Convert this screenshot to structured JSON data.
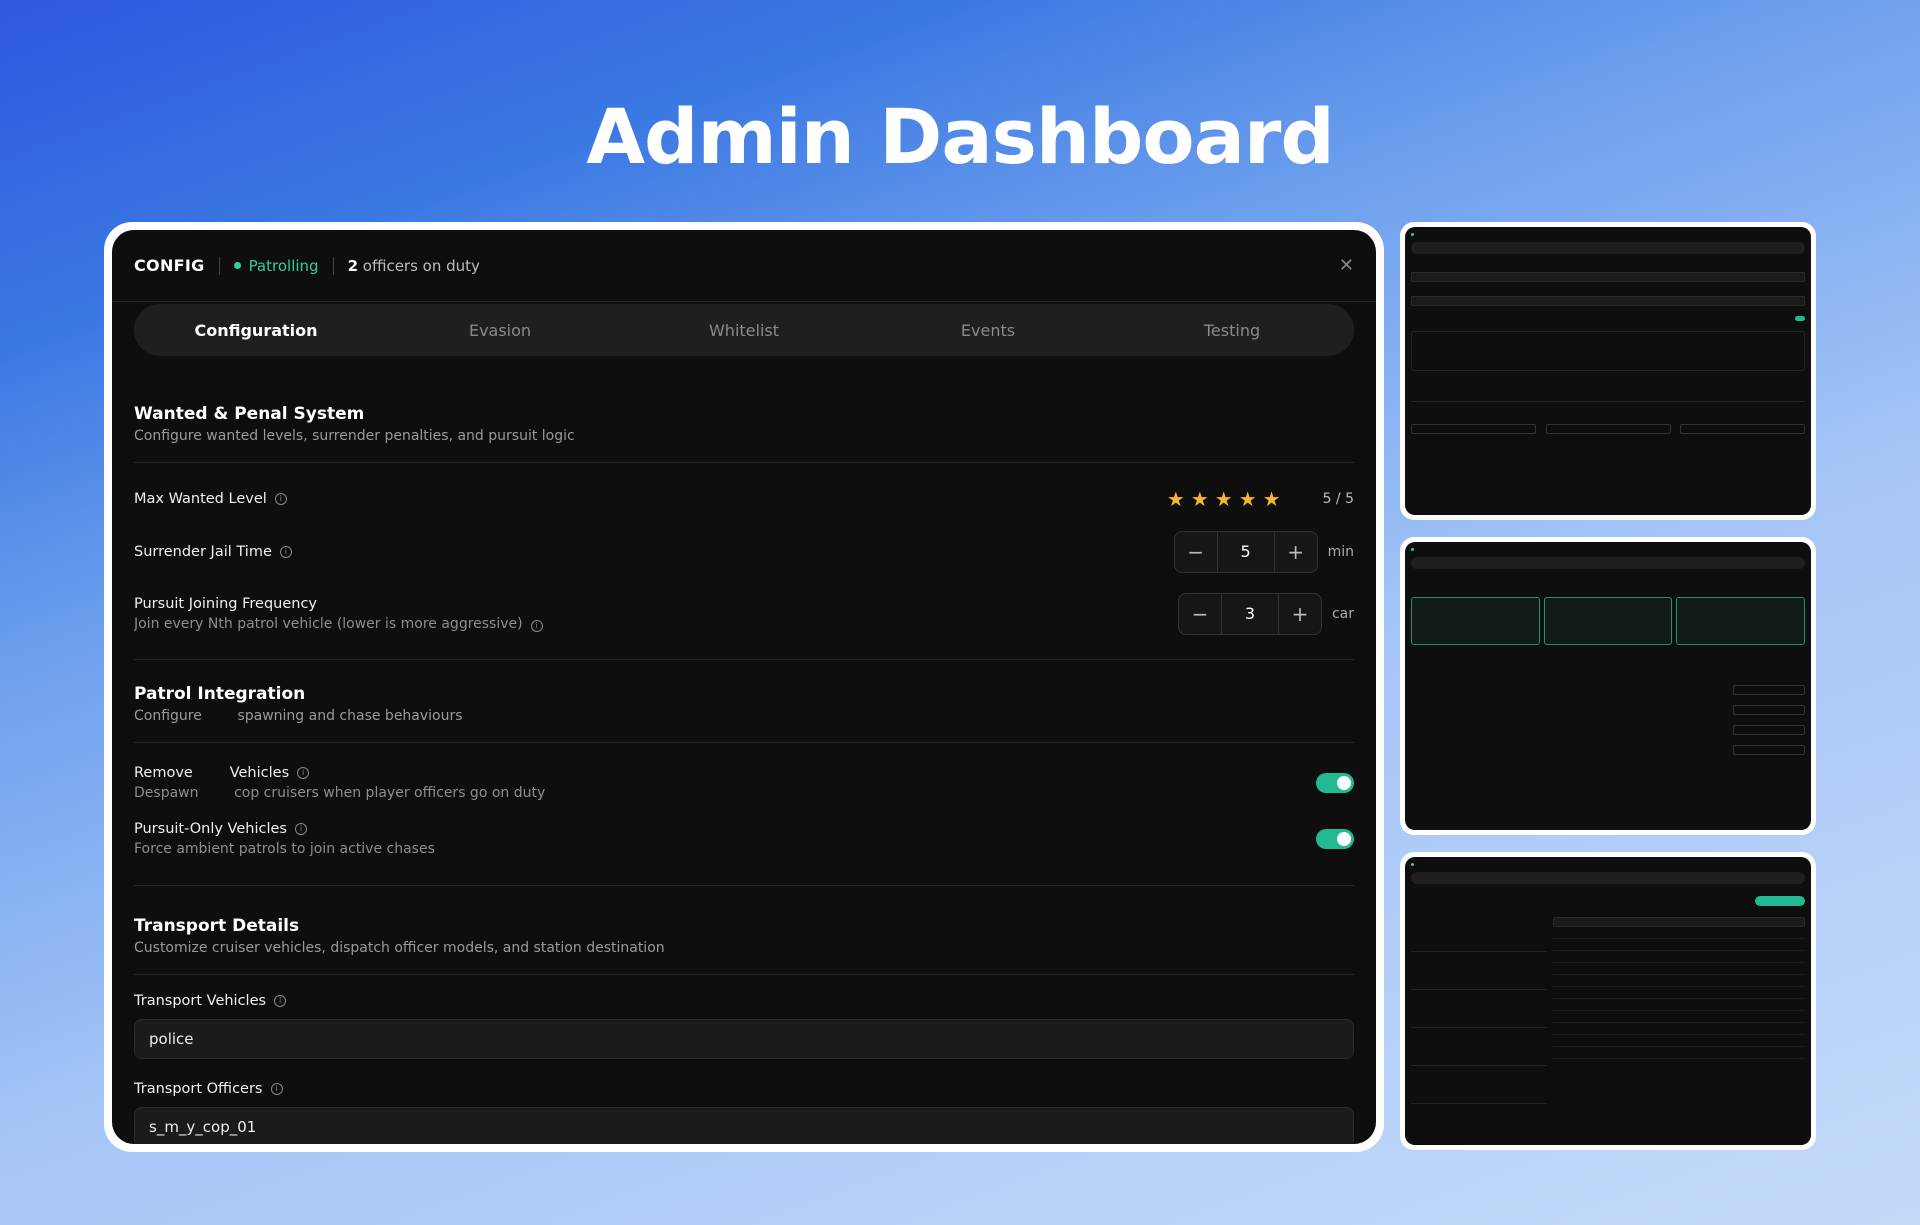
{
  "hero_title": "Admin Dashboard",
  "header": {
    "config_label": "CONFIG",
    "status": "Patrolling",
    "officers_count": "2",
    "officers_label": "officers on duty",
    "close_glyph": "✕"
  },
  "tabs": [
    "Configuration",
    "Evasion",
    "Whitelist",
    "Events",
    "Testing"
  ],
  "wanted": {
    "title": "Wanted & Penal System",
    "desc": "Configure wanted levels, surrender penalties, and pursuit logic",
    "max_label": "Max Wanted Level",
    "max_value": 5,
    "max_text": "5 / 5",
    "jail_label": "Surrender Jail Time",
    "jail_value": "5",
    "jail_unit": "min",
    "pursuit_label": "Pursuit Joining Frequency",
    "pursuit_desc": "Join every Nth patrol vehicle (lower is more aggressive)",
    "pursuit_value": "3",
    "pursuit_unit": "car"
  },
  "patrol": {
    "title": "Patrol Integration",
    "desc": "Configure        spawning and chase behaviours",
    "remove_label": "Remove        Vehicles",
    "remove_desc": "Despawn        cop cruisers when player officers go on duty",
    "remove_on": true,
    "pursuit_only_label": "Pursuit-Only Vehicles",
    "pursuit_only_desc": "Force ambient patrols to join active chases",
    "pursuit_only_on": true
  },
  "transport": {
    "title": "Transport Details",
    "desc": "Customize cruiser vehicles, dispatch officer models, and station destination",
    "vehicles_label": "Transport Vehicles",
    "vehicles_value": "police",
    "officers_label": "Transport Officers",
    "officers_value": "s_m_y_cop_01"
  },
  "colors": {
    "accent": "#21b892",
    "star": "#f5b72b",
    "status": "#2fcf9f"
  },
  "icons": {
    "minus": "−",
    "plus": "+",
    "star": "★",
    "info": "i"
  }
}
